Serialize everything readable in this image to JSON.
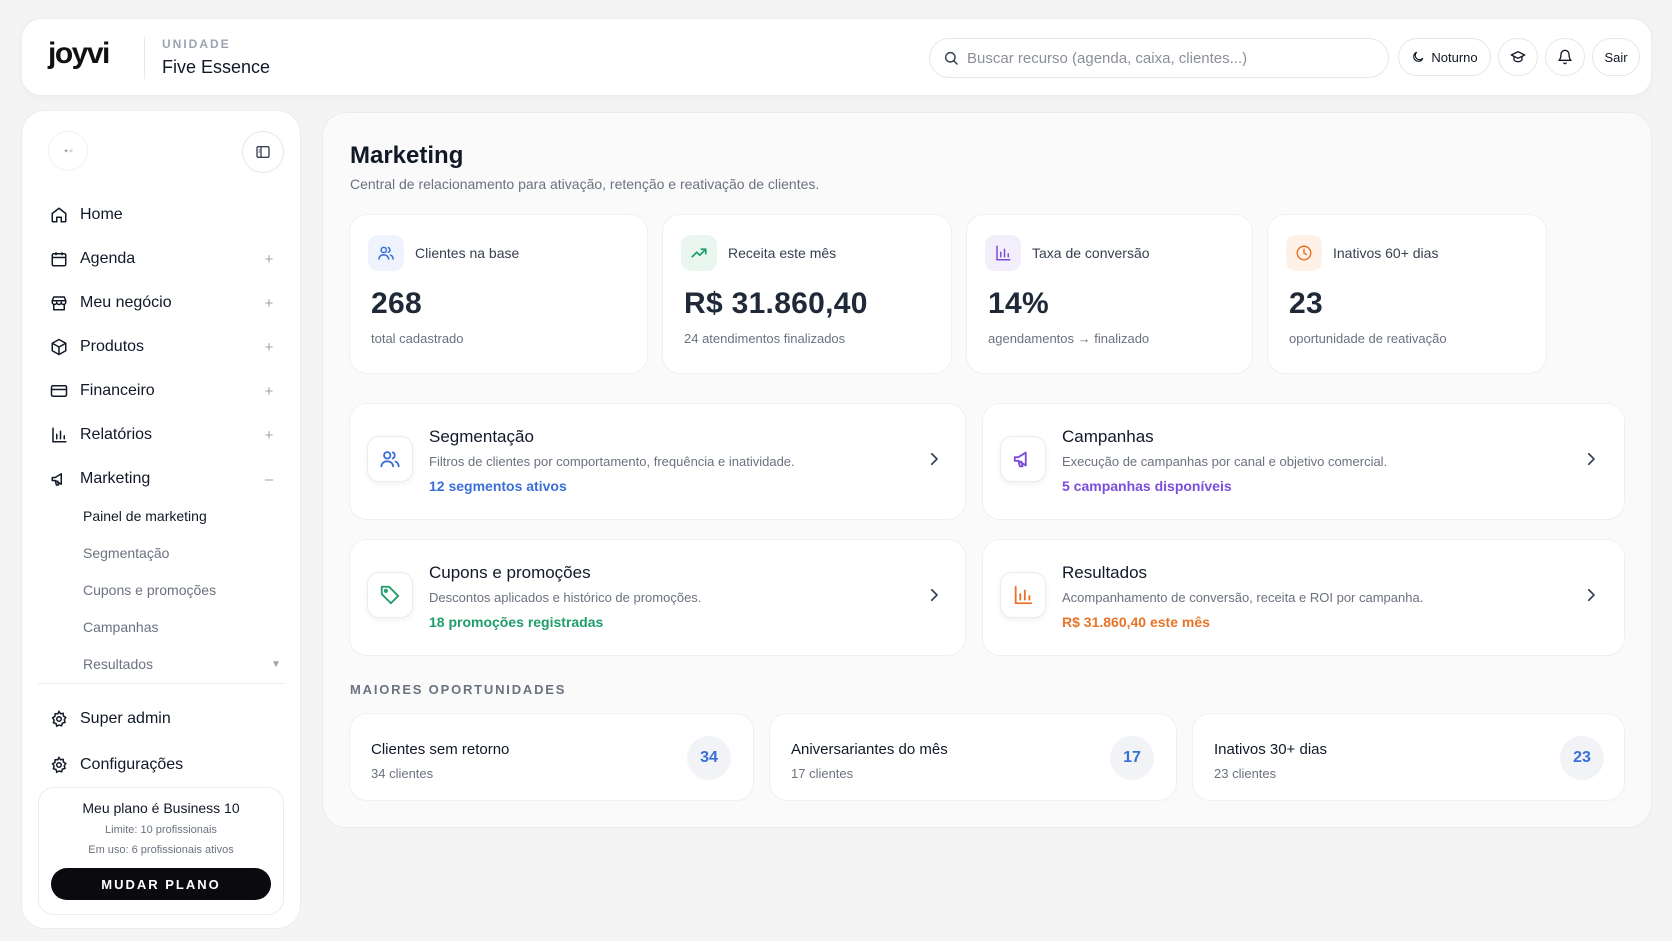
{
  "header": {
    "logo": "joyvi",
    "unit_label": "UNIDADE",
    "unit_name": "Five Essence",
    "search_placeholder": "Buscar recurso (agenda, caixa, clientes...)",
    "theme_label": "Noturno",
    "logout_label": "Sair"
  },
  "sidebar": {
    "nav": [
      {
        "label": "Home",
        "toggle": ""
      },
      {
        "label": "Agenda",
        "toggle": "+"
      },
      {
        "label": "Meu negócio",
        "toggle": "+"
      },
      {
        "label": "Produtos",
        "toggle": "+"
      },
      {
        "label": "Financeiro",
        "toggle": "+"
      },
      {
        "label": "Relatórios",
        "toggle": "+"
      },
      {
        "label": "Marketing",
        "toggle": "–"
      }
    ],
    "marketing_sub": [
      "Painel de marketing",
      "Segmentação",
      "Cupons e promoções",
      "Campanhas",
      "Resultados"
    ],
    "bottom_nav": [
      "Super admin",
      "Configurações"
    ],
    "plan": {
      "title": "Meu plano é Business 10",
      "limit": "Limite: 10 profissionais",
      "usage": "Em uso: 6 profissionais ativos",
      "button": "MUDAR PLANO"
    }
  },
  "main": {
    "title": "Marketing",
    "subtitle": "Central de relacionamento para ativação, retenção e reativação de clientes.",
    "stats": [
      {
        "label": "Clientes na base",
        "value": "268",
        "caption": "total cadastrado",
        "icon": "users-icon",
        "color": "#3b6fd8"
      },
      {
        "label": "Receita este mês",
        "value": "R$ 31.860,40",
        "caption": "24 atendimentos finalizados",
        "icon": "trending-up-icon",
        "color": "#1f9d6b"
      },
      {
        "label": "Taxa de conversão",
        "value": "14%",
        "caption": "agendamentos → finalizado",
        "icon": "bar-chart-icon",
        "color": "#7c4ddb"
      },
      {
        "label": "Inativos 60+ dias",
        "value": "23",
        "caption": "oportunidade de reativação",
        "icon": "clock-icon",
        "color": "#e8742a"
      }
    ],
    "features": [
      {
        "title": "Segmentação",
        "desc": "Filtros de clientes por comportamento, frequência e inatividade.",
        "link": "12 segmentos ativos",
        "color": "#3b6fd8",
        "icon": "users-icon"
      },
      {
        "title": "Campanhas",
        "desc": "Execução de campanhas por canal e objetivo comercial.",
        "link": "5 campanhas disponíveis",
        "color": "#7c4ddb",
        "icon": "megaphone-icon"
      },
      {
        "title": "Cupons e promoções",
        "desc": "Descontos aplicados e histórico de promoções.",
        "link": "18 promoções registradas",
        "color": "#1f9d6b",
        "icon": "tag-icon"
      },
      {
        "title": "Resultados",
        "desc": "Acompanhamento de conversão, receita e ROI por campanha.",
        "link": "R$ 31.860,40 este mês",
        "color": "#e8742a",
        "icon": "bar-chart-icon"
      }
    ],
    "opportunities_label": "MAIORES OPORTUNIDADES",
    "opportunities": [
      {
        "title": "Clientes sem retorno",
        "sub": "34 clientes",
        "count": "34"
      },
      {
        "title": "Aniversariantes do mês",
        "sub": "17 clientes",
        "count": "17"
      },
      {
        "title": "Inativos 30+ dias",
        "sub": "23 clientes",
        "count": "23"
      }
    ]
  }
}
